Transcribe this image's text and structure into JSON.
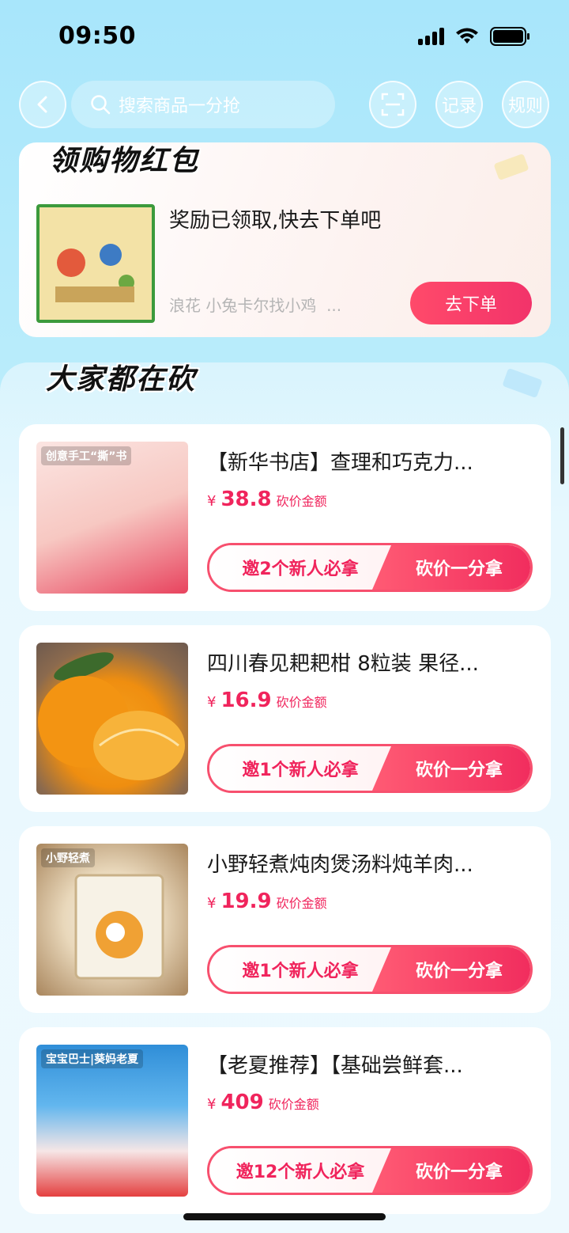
{
  "status_bar": {
    "time": "09:50"
  },
  "top_bar": {
    "search_placeholder": "搜索商品一分抢",
    "record_label": "记录",
    "rule_label": "规则"
  },
  "reward": {
    "title": "领购物红包",
    "message": "奖励已领取,快去下单吧",
    "product_name": "浪花 小兔卡尔找小鸡",
    "ellipsis": "...",
    "order_button": "去下单"
  },
  "list": {
    "title": "大家都在砍",
    "currency": "¥",
    "price_label": "砍价金额",
    "bargain_label": "砍价一分拿",
    "items": [
      {
        "name": "【新华书店】查理和巧克力...",
        "price": "38.8",
        "invite": "邀2个新人必拿",
        "image_caption": "创意手工“撕”书"
      },
      {
        "name": "四川春见耙耙柑 8粒装 果径...",
        "price": "16.9",
        "invite": "邀1个新人必拿",
        "image_caption": ""
      },
      {
        "name": "小野轻煮炖肉煲汤料炖羊肉...",
        "price": "19.9",
        "invite": "邀1个新人必拿",
        "image_caption": "小野轻煮"
      },
      {
        "name": "【老夏推荐】【基础尝鲜套...",
        "price": "409",
        "invite": "邀12个新人必拿",
        "image_caption": "宝宝巴士|葵妈老夏"
      }
    ]
  }
}
